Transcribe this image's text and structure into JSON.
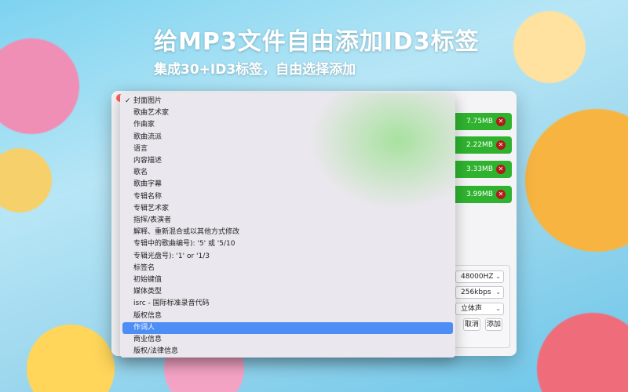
{
  "headline": "给MP3文件自由添加ID3标签",
  "subline": "集成30+ID3标签，自由选择添加",
  "files": [
    {
      "size": "7.75MB"
    },
    {
      "size": "2.22MB"
    },
    {
      "size": "3.33MB"
    },
    {
      "size": "3.99MB"
    }
  ],
  "settings": {
    "sample_rate": "48000HZ",
    "bitrate": "256kbps",
    "channel": "立体声",
    "cancel_label": "取消",
    "add_label": "添加"
  },
  "dropdown": {
    "checked_index": 0,
    "selected_index": 19,
    "items": [
      "封面图片",
      "歌曲艺术家",
      "作曲家",
      "歌曲流派",
      "语言",
      "内容描述",
      "歌名",
      "歌曲字幕",
      "专辑名称",
      "专辑艺术家",
      "指挥/表演者",
      "解释、重新混合或以其他方式修改",
      "专辑中的歌曲编号): '5' 或 '5/10",
      "专辑光盘号): '1' or '1/3",
      "标签名",
      "初始键值",
      "媒体类型",
      "isrc - 国际标准录音代码",
      "版权信息",
      "作词人",
      "商业信息",
      "版权/法律信息"
    ]
  },
  "colors": {
    "accent": "#4c8ef5",
    "file_pill": "#2fb32f",
    "remove_icon": "#b11a1a"
  }
}
